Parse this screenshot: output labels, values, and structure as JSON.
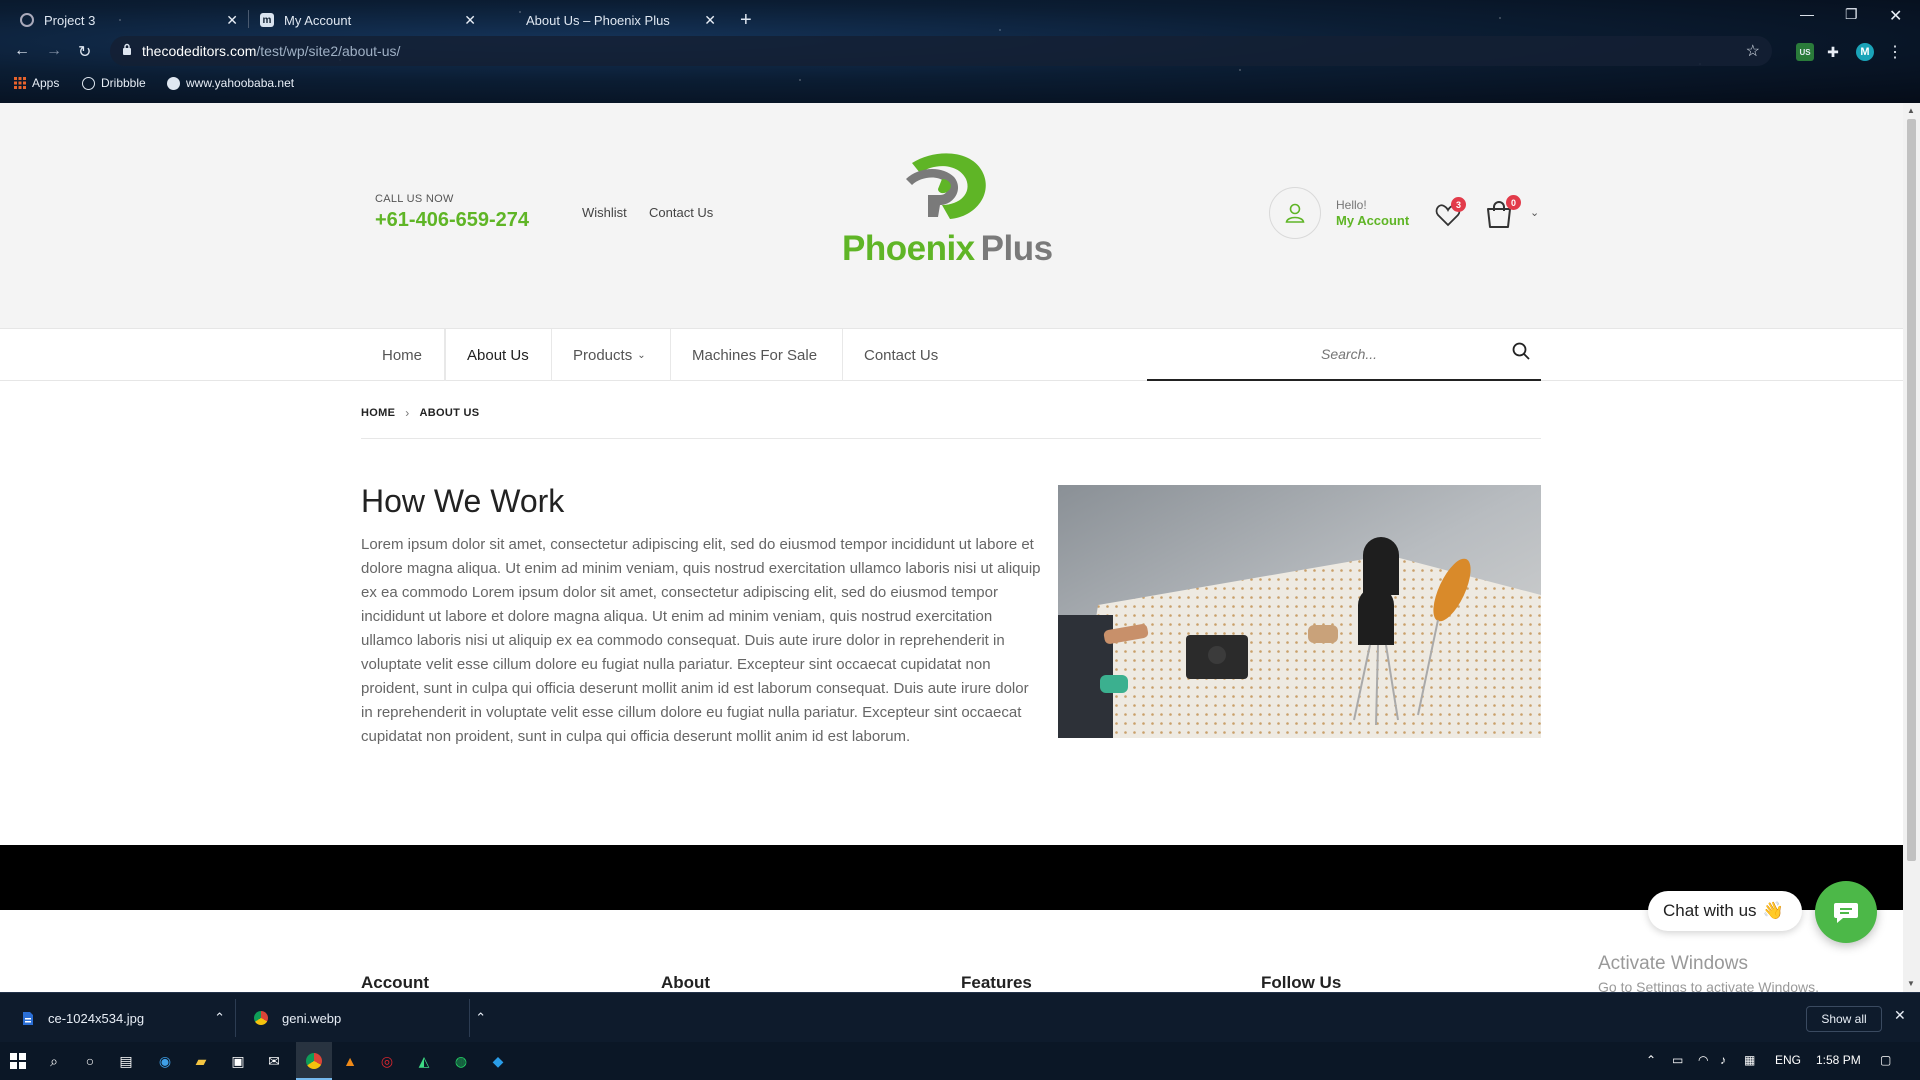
{
  "browser": {
    "tabs": [
      {
        "title": "Project 3",
        "active": false
      },
      {
        "title": "My Account",
        "active": false
      },
      {
        "title": "About Us – Phoenix Plus",
        "active": true
      }
    ],
    "url_host": "thecodeditors.com",
    "url_path": "/test/wp/site2/about-us/",
    "profile_initial": "M",
    "ext_badge": "US",
    "bookmarks": [
      {
        "label": "Apps",
        "icon": "apps-grid-icon"
      },
      {
        "label": "Dribbble",
        "icon": "dribbble-icon"
      },
      {
        "label": "www.yahoobaba.net",
        "icon": "globe-icon"
      }
    ]
  },
  "header": {
    "call_label": "CALL US NOW",
    "phone": "+61-406-659-274",
    "links": [
      "Wishlist",
      "Contact Us"
    ],
    "logo": {
      "part1": "Phoenix",
      "part2": "Plus"
    },
    "hello": "Hello!",
    "my_account": "My Account",
    "wishlist_count": "3",
    "cart_count": "0"
  },
  "nav": {
    "items": [
      "Home",
      "About Us",
      "Products",
      "Machines For Sale",
      "Contact Us"
    ],
    "active": "About Us",
    "search_placeholder": "Search..."
  },
  "breadcrumb": {
    "home": "HOME",
    "current": "ABOUT US"
  },
  "content": {
    "heading": "How We Work",
    "paragraph": "Lorem ipsum dolor sit amet, consectetur adipiscing elit, sed do eiusmod tempor incididunt ut labore et dolore magna aliqua. Ut enim ad minim veniam, quis nostrud exercitation ullamco laboris nisi ut aliquip ex ea commodo Lorem ipsum dolor sit amet, consectetur adipiscing elit, sed do eiusmod tempor incididunt ut labore et dolore magna aliqua. Ut enim ad minim veniam, quis nostrud exercitation ullamco laboris nisi ut aliquip ex ea commodo consequat. Duis aute irure dolor in reprehenderit in voluptate velit esse cillum dolore eu fugiat nulla pariatur. Excepteur sint occaecat cupidatat non proident, sunt in culpa qui officia deserunt mollit anim id est laborum consequat. Duis aute irure dolor in reprehenderit in voluptate velit esse cillum dolore eu fugiat nulla pariatur. Excepteur sint occaecat cupidatat non proident, sunt in culpa qui officia deserunt mollit anim id est laborum."
  },
  "footer": {
    "columns": [
      "Account",
      "About",
      "Features",
      "Follow Us"
    ]
  },
  "chat": {
    "label": "Chat with us",
    "emoji": "👋"
  },
  "activation": {
    "line1": "Activate Windows",
    "line2": "Go to Settings to activate Windows."
  },
  "downloads": {
    "items": [
      {
        "name": "ce-1024x534.jpg",
        "icon": "file-icon"
      },
      {
        "name": "geni.webp",
        "icon": "chrome-icon"
      }
    ],
    "show_all": "Show all"
  },
  "taskbar": {
    "language": "ENG",
    "time": "1:58 PM"
  },
  "colors": {
    "brand_green": "#5fb526",
    "badge_red": "#e23b4a",
    "chat_green": "#4cb848"
  }
}
